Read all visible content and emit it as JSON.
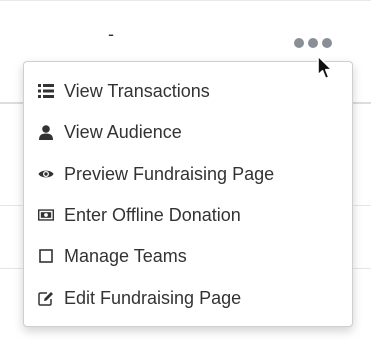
{
  "header": {
    "dash": "-"
  },
  "menu": {
    "items": [
      {
        "label": "View Transactions",
        "icon": "list-icon"
      },
      {
        "label": "View Audience",
        "icon": "user-icon"
      },
      {
        "label": "Preview Fundraising Page",
        "icon": "eye-icon"
      },
      {
        "label": "Enter Offline Donation",
        "icon": "money-icon"
      },
      {
        "label": "Manage Teams",
        "icon": "square-outline-icon"
      },
      {
        "label": "Edit Fundraising Page",
        "icon": "edit-icon"
      }
    ]
  },
  "colors": {
    "text": "#333333",
    "dots": "#8a8f95",
    "menu_border": "#cfcfcf"
  }
}
